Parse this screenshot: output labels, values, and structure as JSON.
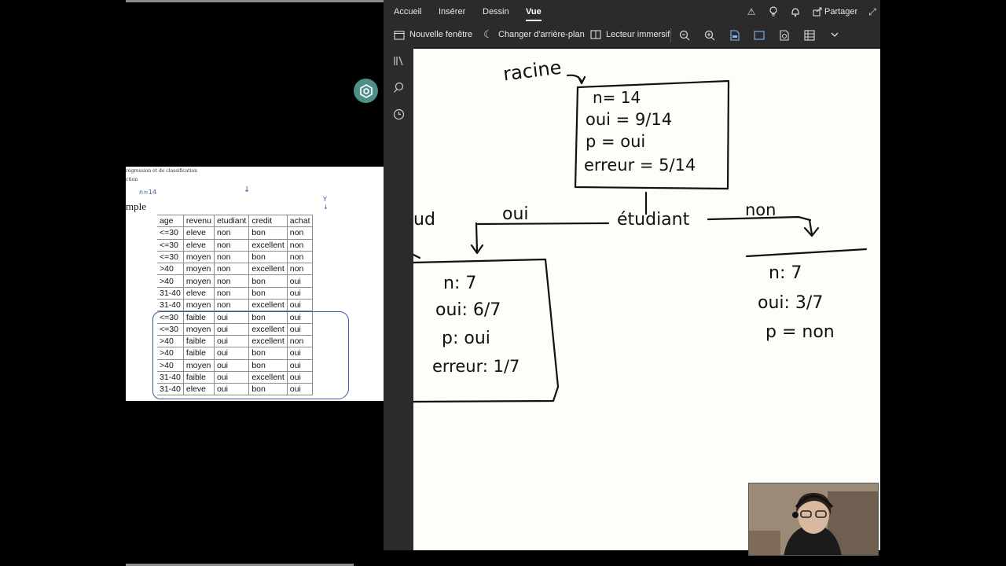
{
  "slide": {
    "header_line1": "régression et de classification",
    "header_line2": "ction",
    "title": "mple",
    "anno_n": "n=14",
    "anno_y": "Y",
    "table": {
      "columns": [
        "age",
        "revenu",
        "etudiant",
        "credit",
        "achat"
      ],
      "rows": [
        [
          "<=30",
          "eleve",
          "non",
          "bon",
          "non"
        ],
        [
          "<=30",
          "eleve",
          "non",
          "excellent",
          "non"
        ],
        [
          "<=30",
          "moyen",
          "non",
          "bon",
          "non"
        ],
        [
          ">40",
          "moyen",
          "non",
          "excellent",
          "non"
        ],
        [
          ">40",
          "moyen",
          "non",
          "bon",
          "oui"
        ],
        [
          "31-40",
          "eleve",
          "non",
          "bon",
          "oui"
        ],
        [
          "31-40",
          "moyen",
          "non",
          "excellent",
          "oui"
        ],
        [
          "<=30",
          "faible",
          "oui",
          "bon",
          "oui"
        ],
        [
          "<=30",
          "moyen",
          "oui",
          "excellent",
          "oui"
        ],
        [
          ">40",
          "faible",
          "oui",
          "excellent",
          "non"
        ],
        [
          ">40",
          "faible",
          "oui",
          "bon",
          "oui"
        ],
        [
          ">40",
          "moyen",
          "oui",
          "bon",
          "oui"
        ],
        [
          "31-40",
          "faible",
          "oui",
          "excellent",
          "oui"
        ],
        [
          "31-40",
          "eleve",
          "oui",
          "bon",
          "oui"
        ]
      ]
    }
  },
  "ribbon": {
    "tabs": [
      "Accueil",
      "Insérer",
      "Dessin",
      "Vue"
    ],
    "active_tab": "Vue",
    "share_label": "Partager"
  },
  "toolbar": {
    "new_window": "Nouvelle fenêtre",
    "change_background": "Changer d'arrière-plan",
    "immersive_reader": "Lecteur immersif"
  },
  "ink": {
    "root_label": "racine",
    "root": {
      "n": "n= 14",
      "oui": "oui = 9/14",
      "p": "p = oui",
      "erreur": "erreur = 5/14"
    },
    "split_feature": "étudiant",
    "branch_left": "oui",
    "branch_right": "non",
    "left_fragment": "ud",
    "left_node": {
      "n": "n: 7",
      "oui": "oui: 6/7",
      "p": "p: oui",
      "erreur": "erreur: 1/7"
    },
    "right_node": {
      "n": "n: 7",
      "oui": "oui: 3/7",
      "p": "p = non"
    }
  },
  "colors": {
    "app_dark": "#2b2b2b",
    "canvas": "#fdfdf9",
    "annotation_blue": "#3b57a0",
    "badge_teal": "#4f8f8a"
  }
}
